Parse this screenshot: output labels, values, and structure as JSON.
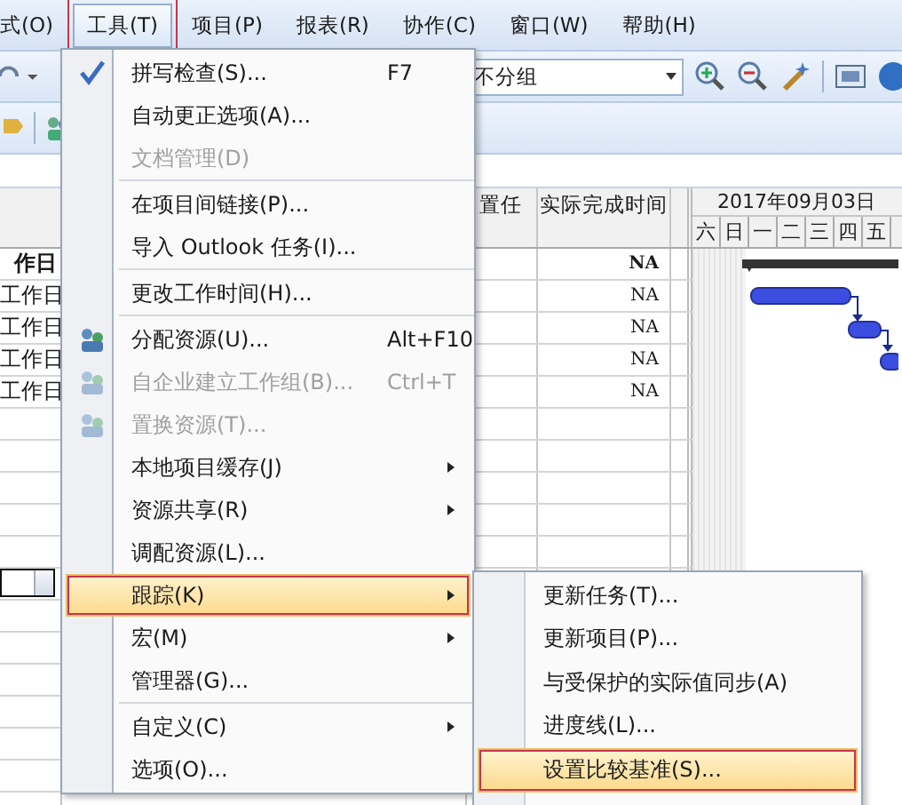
{
  "menu_bar": [
    {
      "label": "式(O)",
      "selected": false
    },
    {
      "label": "工具(T)",
      "selected": true
    },
    {
      "label": "项目(P)",
      "selected": false
    },
    {
      "label": "报表(R)",
      "selected": false
    },
    {
      "label": "协作(C)",
      "selected": false
    },
    {
      "label": "窗口(W)",
      "selected": false
    },
    {
      "label": "帮助(H)",
      "selected": false
    }
  ],
  "toolbar": {
    "group_select": {
      "value": "不分组"
    }
  },
  "table": {
    "columns": [
      {
        "label": "置任"
      },
      {
        "label": "实际完成时间"
      }
    ],
    "rows": [
      {
        "column_1": "作日",
        "actual_finish": "NA",
        "summary": true
      },
      {
        "column_1": "工作日",
        "actual_finish": "NA",
        "summary": false
      },
      {
        "column_1": "工作日",
        "actual_finish": "NA",
        "summary": false
      },
      {
        "column_1": "工作日",
        "actual_finish": "NA",
        "summary": false
      },
      {
        "column_1": "工作日",
        "actual_finish": "NA",
        "summary": false
      }
    ]
  },
  "gantt": {
    "date": "2017年09月03日",
    "days": [
      "六",
      "日",
      "一",
      "二",
      "三",
      "四",
      "五"
    ]
  },
  "tools_menu": {
    "items": [
      {
        "kind": "item",
        "label": "拼写检查(S)...",
        "shortcut": "F7",
        "icon": true,
        "disabled": false,
        "submenu": false,
        "selected": false
      },
      {
        "kind": "item",
        "label": "自动更正选项(A)...",
        "icon": false,
        "disabled": false,
        "submenu": false,
        "selected": false
      },
      {
        "kind": "item",
        "label": "文档管理(D)",
        "icon": false,
        "disabled": true,
        "submenu": false,
        "selected": false
      },
      {
        "kind": "separator"
      },
      {
        "kind": "item",
        "label": "在项目间链接(P)...",
        "icon": false,
        "disabled": false,
        "submenu": false,
        "selected": false
      },
      {
        "kind": "item",
        "label": "导入 Outlook 任务(I)...",
        "icon": false,
        "disabled": false,
        "submenu": false,
        "selected": false
      },
      {
        "kind": "separator"
      },
      {
        "kind": "item",
        "label": "更改工作时间(H)...",
        "icon": false,
        "disabled": false,
        "submenu": false,
        "selected": false
      },
      {
        "kind": "separator"
      },
      {
        "kind": "item",
        "label": "分配资源(U)...",
        "shortcut": "Alt+F10",
        "icon": true,
        "disabled": false,
        "submenu": false,
        "selected": false
      },
      {
        "kind": "item",
        "label": "自企业建立工作组(B)...",
        "shortcut": "Ctrl+T",
        "icon": true,
        "disabled": true,
        "submenu": false,
        "selected": false
      },
      {
        "kind": "item",
        "label": "置换资源(T)...",
        "icon": true,
        "disabled": true,
        "submenu": false,
        "selected": false
      },
      {
        "kind": "item",
        "label": "本地项目缓存(J)",
        "icon": false,
        "disabled": false,
        "submenu": true,
        "selected": false
      },
      {
        "kind": "item",
        "label": "资源共享(R)",
        "icon": false,
        "disabled": false,
        "submenu": true,
        "selected": false
      },
      {
        "kind": "item",
        "label": "调配资源(L)...",
        "icon": false,
        "disabled": false,
        "submenu": false,
        "selected": false
      },
      {
        "kind": "item",
        "label": "跟踪(K)",
        "icon": false,
        "disabled": false,
        "submenu": true,
        "selected": true
      },
      {
        "kind": "item",
        "label": "宏(M)",
        "icon": false,
        "disabled": false,
        "submenu": true,
        "selected": false
      },
      {
        "kind": "item",
        "label": "管理器(G)...",
        "icon": false,
        "disabled": false,
        "submenu": false,
        "selected": false
      },
      {
        "kind": "separator"
      },
      {
        "kind": "item",
        "label": "自定义(C)",
        "icon": false,
        "disabled": false,
        "submenu": true,
        "selected": false
      },
      {
        "kind": "item",
        "label": "选项(O)...",
        "icon": false,
        "disabled": false,
        "submenu": false,
        "selected": false
      }
    ]
  },
  "tracking_submenu": {
    "items": [
      {
        "label": "更新任务(T)...",
        "selected": false
      },
      {
        "label": "更新项目(P)...",
        "selected": false
      },
      {
        "label": "与受保护的实际值同步(A)",
        "selected": false
      },
      {
        "label": "进度线(L)...",
        "selected": false
      },
      {
        "label": "设置比较基准(S)...",
        "selected": true
      }
    ]
  }
}
